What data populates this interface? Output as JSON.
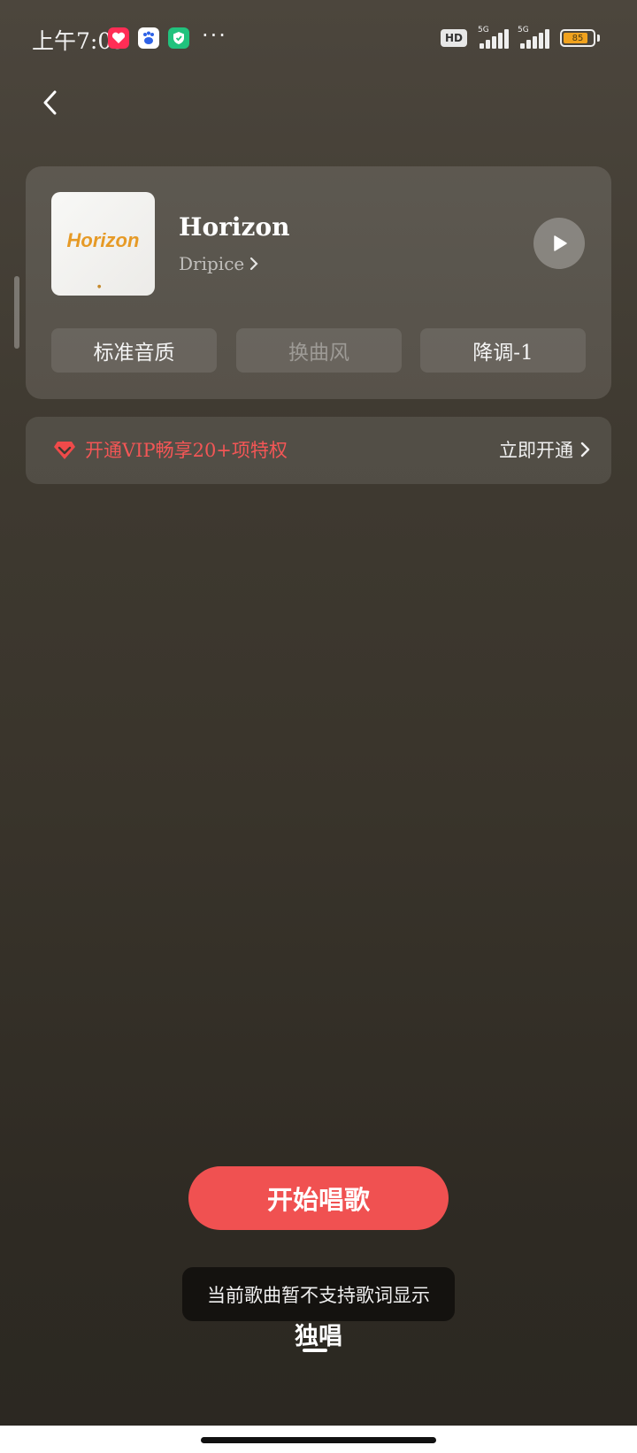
{
  "status_bar": {
    "time": "上午7:09",
    "more_dots": "···",
    "hd_label": "HD",
    "network_1": "5G",
    "network_2": "5G",
    "battery_level": "85",
    "battery_fraction": 0.85
  },
  "song": {
    "title": "Horizon",
    "artist": "Dripice",
    "cover_text": "Horizon"
  },
  "options": [
    {
      "label": "标准音质",
      "enabled": true
    },
    {
      "label": "换曲风",
      "enabled": false
    },
    {
      "label": "降调-1",
      "enabled": true
    }
  ],
  "vip": {
    "text": "开通VIP畅享20+项特权",
    "action": "立即开通"
  },
  "start_button": "开始唱歌",
  "toast": "当前歌曲暂不支持歌词显示",
  "mode_tab": "独唱",
  "colors": {
    "accent_red": "#f05151",
    "vip_text": "#f35656",
    "battery": "#f0a21e"
  }
}
